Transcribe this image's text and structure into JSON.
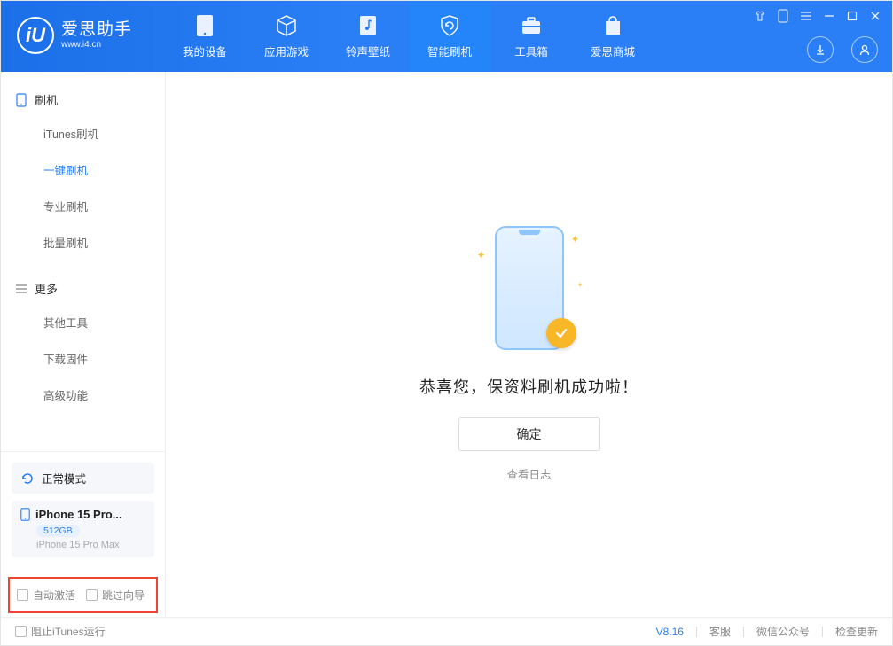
{
  "app": {
    "name": "爱思助手",
    "site": "www.i4.cn",
    "logo_letter": "iU"
  },
  "top_nav": [
    {
      "label": "我的设备"
    },
    {
      "label": "应用游戏"
    },
    {
      "label": "铃声壁纸"
    },
    {
      "label": "智能刷机",
      "active": true
    },
    {
      "label": "工具箱"
    },
    {
      "label": "爱思商城"
    }
  ],
  "sidebar": {
    "group1": {
      "title": "刷机",
      "items": [
        {
          "label": "iTunes刷机"
        },
        {
          "label": "一键刷机",
          "active": true
        },
        {
          "label": "专业刷机"
        },
        {
          "label": "批量刷机"
        }
      ]
    },
    "group2": {
      "title": "更多",
      "items": [
        {
          "label": "其他工具"
        },
        {
          "label": "下载固件"
        },
        {
          "label": "高级功能"
        }
      ]
    }
  },
  "device": {
    "mode": "正常模式",
    "name": "iPhone 15 Pro...",
    "storage": "512GB",
    "full_name": "iPhone 15 Pro Max"
  },
  "checkbox_row": {
    "auto_activate": "自动激活",
    "skip_wizard": "跳过向导"
  },
  "main": {
    "success_text": "恭喜您，保资料刷机成功啦！",
    "ok_label": "确定",
    "view_log": "查看日志"
  },
  "footer": {
    "block_itunes": "阻止iTunes运行",
    "version": "V8.16",
    "support": "客服",
    "wechat": "微信公众号",
    "check_update": "检查更新"
  }
}
